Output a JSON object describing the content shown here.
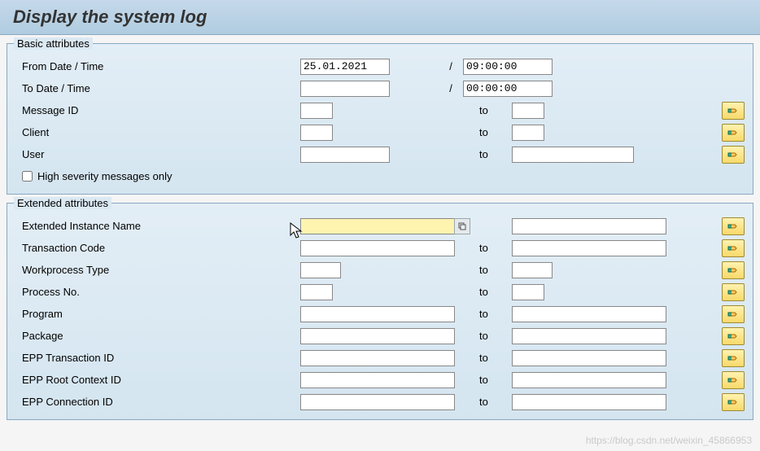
{
  "header": {
    "title": "Display the system log"
  },
  "basic": {
    "title": "Basic attributes",
    "from_label": "From Date / Time",
    "to_label": "To Date / Time",
    "msgid_label": "Message ID",
    "client_label": "Client",
    "user_label": "User",
    "highsev_label": "High severity messages only",
    "from_date": "25.01.2021",
    "from_time": "09:00:00",
    "to_date": "",
    "to_time": "00:00:00",
    "msgid_from": "",
    "msgid_to": "",
    "client_from": "",
    "client_to": "",
    "user_from": "",
    "user_to": "",
    "sep": "/",
    "to": "to"
  },
  "ext": {
    "title": "Extended attributes",
    "instance_label": "Extended Instance Name",
    "tcode_label": "Transaction Code",
    "wptype_label": "Workprocess Type",
    "procno_label": "Process No.",
    "program_label": "Program",
    "package_label": "Package",
    "epp_tid_label": "EPP Transaction ID",
    "epp_rcid_label": "EPP Root Context ID",
    "epp_conn_label": "EPP Connection ID",
    "instance_from": "",
    "instance_to": "",
    "tcode_from": "",
    "tcode_to": "",
    "wptype_from": "",
    "wptype_to": "",
    "procno_from": "",
    "procno_to": "",
    "program_from": "",
    "program_to": "",
    "package_from": "",
    "package_to": "",
    "epp_tid_from": "",
    "epp_tid_to": "",
    "epp_rcid_from": "",
    "epp_rcid_to": "",
    "epp_conn_from": "",
    "epp_conn_to": "",
    "to": "to"
  },
  "watermark": "https://blog.csdn.net/weixin_45866953"
}
